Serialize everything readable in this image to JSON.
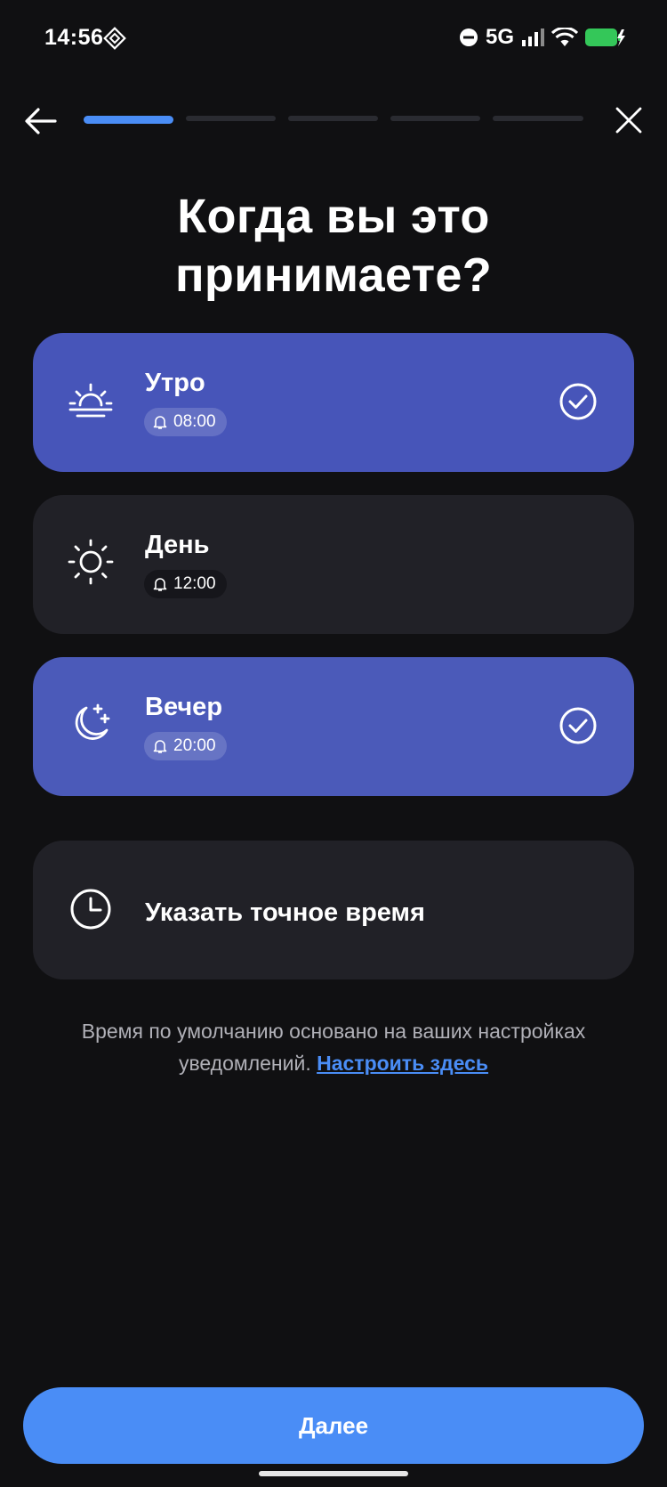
{
  "status_bar": {
    "time": "14:56",
    "network": "5G",
    "icons": [
      "app-notification-icon",
      "do-not-disturb-icon",
      "signal-icon",
      "wifi-icon",
      "battery-charging-icon"
    ]
  },
  "nav": {
    "back_icon": "arrow-left-icon",
    "close_icon": "close-icon",
    "progress": {
      "current_step": 1,
      "total_steps": 5
    }
  },
  "title": "Когда вы это принимаете?",
  "options": [
    {
      "label": "Утро",
      "time": "08:00",
      "icon": "sunrise-icon",
      "selected": true
    },
    {
      "label": "День",
      "time": "12:00",
      "icon": "sun-icon",
      "selected": false
    },
    {
      "label": "Вечер",
      "time": "20:00",
      "icon": "moon-stars-icon",
      "selected": true
    },
    {
      "label": "Указать точное время",
      "icon": "clock-icon",
      "selected": false
    }
  ],
  "note": {
    "text": "Время по умолчанию основано на ваших настройках уведомлений.",
    "link": "Настроить здесь"
  },
  "next_button": "Далее",
  "colors": {
    "background": "#101012",
    "selected_card": "#4755b9",
    "card": "#212127",
    "accent": "#4a8df6"
  }
}
